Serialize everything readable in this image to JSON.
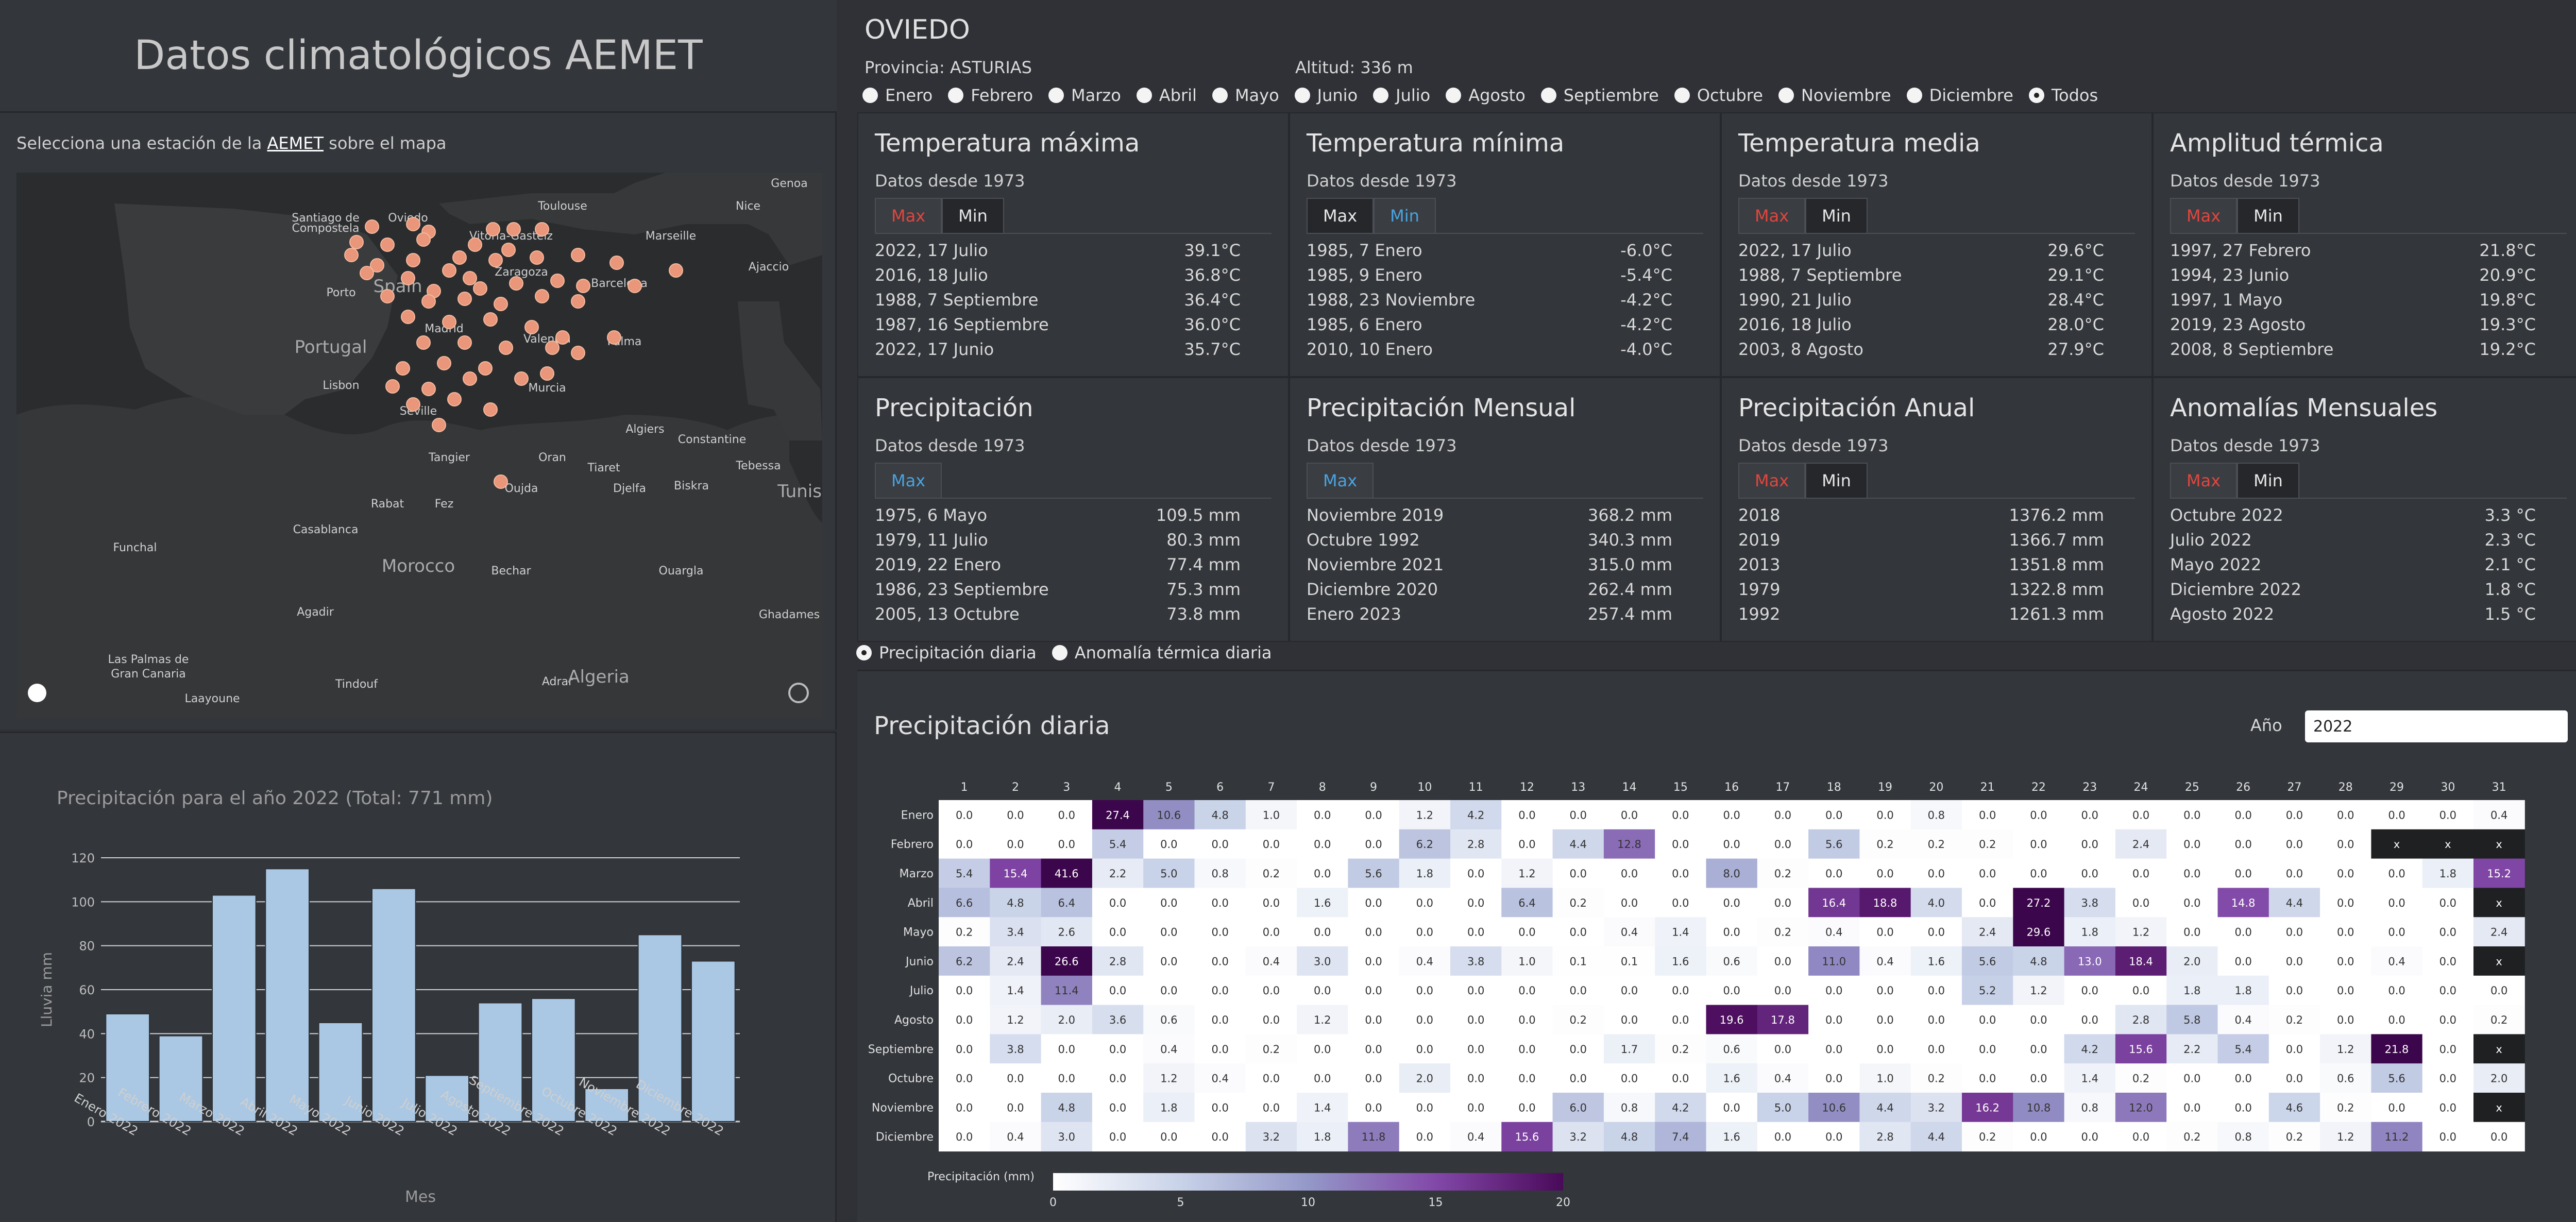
{
  "app_title": "Datos climatológicos AEMET",
  "map": {
    "prompt_prefix": "Selecciona una estación de la ",
    "prompt_link": "AEMET",
    "prompt_suffix": " sobre el mapa",
    "labels": [
      "Santiago de",
      "Compostela",
      "Oviedo",
      "Vitoria-Gasteiz",
      "Toulouse",
      "Nice",
      "Genoa",
      "Marseille",
      "Ajaccio",
      "Zaragoza",
      "Barcelona",
      "Porto",
      "Spain",
      "Madrid",
      "Valencia",
      "Palma",
      "Portugal",
      "Lisbon",
      "Murcia",
      "Seville",
      "Algiers",
      "Constantine",
      "Tunis",
      "Tangier",
      "Oran",
      "Tiaret",
      "Tebessa",
      "Rabat",
      "Fez",
      "Oujda",
      "Djelfa",
      "Biskra",
      "Casablanca",
      "Morocco",
      "Bechar",
      "Ouargla",
      "Funchal",
      "Agadir",
      "Ghadames",
      "Las Palmas de",
      "Gran Canaria",
      "Tindouf",
      "Adrar",
      "Algeria",
      "Laayoune"
    ]
  },
  "bar_chart": {
    "title": "Precipitación para el año 2022 (Total: 771 mm)",
    "xlabel": "Mes",
    "ylabel": "Lluvia mm"
  },
  "chart_data": [
    {
      "type": "bar",
      "title": "Precipitación para el año 2022 (Total: 771 mm)",
      "xlabel": "Mes",
      "ylabel": "Lluvia mm",
      "ylim": [
        0,
        120
      ],
      "yticks": [
        0,
        20,
        40,
        60,
        80,
        100,
        120
      ],
      "categories": [
        "Enero 2022",
        "Febrero 2022",
        "Marzo 2022",
        "Abril 2022",
        "Mayo 2022",
        "Junio 2022",
        "Julio 2022",
        "Agosto 2022",
        "Septiembre 2022",
        "Octubre 2022",
        "Noviembre 2022",
        "Diciembre 2022"
      ],
      "values": [
        49,
        39,
        103,
        115,
        45,
        106,
        21,
        54,
        56,
        15,
        85,
        73
      ],
      "color": "#aac8e4",
      "grid": true
    },
    {
      "type": "heatmap",
      "title": "Precipitación diaria",
      "colorbar_label": "Precipitación (mm)",
      "colorbar_ticks": [
        0,
        5,
        10,
        15,
        20
      ],
      "x": [
        "1",
        "2",
        "3",
        "4",
        "5",
        "6",
        "7",
        "8",
        "9",
        "10",
        "11",
        "12",
        "13",
        "14",
        "15",
        "16",
        "17",
        "18",
        "19",
        "20",
        "21",
        "22",
        "23",
        "24",
        "25",
        "26",
        "27",
        "28",
        "29",
        "30",
        "31"
      ],
      "y": [
        "Enero",
        "Febrero",
        "Marzo",
        "Abril",
        "Mayo",
        "Junio",
        "Julio",
        "Agosto",
        "Septiembre",
        "Octubre",
        "Noviembre",
        "Diciembre"
      ],
      "values": [
        [
          "0.0",
          "0.0",
          "0.0",
          "27.4",
          "10.6",
          "4.8",
          "1.0",
          "0.0",
          "0.0",
          "1.2",
          "4.2",
          "0.0",
          "0.0",
          "0.0",
          "0.0",
          "0.0",
          "0.0",
          "0.0",
          "0.0",
          "0.8",
          "0.0",
          "0.0",
          "0.0",
          "0.0",
          "0.0",
          "0.0",
          "0.0",
          "0.0",
          "0.0",
          "0.0",
          "0.4"
        ],
        [
          "0.0",
          "0.0",
          "0.0",
          "5.4",
          "0.0",
          "0.0",
          "0.0",
          "0.0",
          "0.0",
          "6.2",
          "2.8",
          "0.0",
          "4.4",
          "12.8",
          "0.0",
          "0.0",
          "0.0",
          "5.6",
          "0.2",
          "0.2",
          "0.2",
          "0.0",
          "0.0",
          "2.4",
          "0.0",
          "0.0",
          "0.0",
          "0.0",
          "x",
          "x",
          "x"
        ],
        [
          "5.4",
          "15.4",
          "41.6",
          "2.2",
          "5.0",
          "0.8",
          "0.2",
          "0.0",
          "5.6",
          "1.8",
          "0.0",
          "1.2",
          "0.0",
          "0.0",
          "0.0",
          "8.0",
          "0.2",
          "0.0",
          "0.0",
          "0.0",
          "0.0",
          "0.0",
          "0.0",
          "0.0",
          "0.0",
          "0.0",
          "0.0",
          "0.0",
          "0.0",
          "1.8",
          "15.2"
        ],
        [
          "6.6",
          "4.8",
          "6.4",
          "0.0",
          "0.0",
          "0.0",
          "0.0",
          "1.6",
          "0.0",
          "0.0",
          "0.0",
          "6.4",
          "0.2",
          "0.0",
          "0.0",
          "0.0",
          "0.0",
          "16.4",
          "18.8",
          "4.0",
          "0.0",
          "27.2",
          "3.8",
          "0.0",
          "0.0",
          "14.8",
          "4.4",
          "0.0",
          "0.0",
          "0.0",
          "x"
        ],
        [
          "0.2",
          "3.4",
          "2.6",
          "0.0",
          "0.0",
          "0.0",
          "0.0",
          "0.0",
          "0.0",
          "0.0",
          "0.0",
          "0.0",
          "0.0",
          "0.4",
          "1.4",
          "0.0",
          "0.2",
          "0.4",
          "0.0",
          "0.0",
          "2.4",
          "29.6",
          "1.8",
          "1.2",
          "0.0",
          "0.0",
          "0.0",
          "0.0",
          "0.0",
          "0.0",
          "2.4"
        ],
        [
          "6.2",
          "2.4",
          "26.6",
          "2.8",
          "0.0",
          "0.0",
          "0.4",
          "3.0",
          "0.0",
          "0.4",
          "3.8",
          "1.0",
          "0.1",
          "0.1",
          "1.6",
          "0.6",
          "0.0",
          "11.0",
          "0.4",
          "1.6",
          "5.6",
          "4.8",
          "13.0",
          "18.4",
          "2.0",
          "0.0",
          "0.0",
          "0.0",
          "0.4",
          "0.0",
          "x"
        ],
        [
          "0.0",
          "1.4",
          "11.4",
          "0.0",
          "0.0",
          "0.0",
          "0.0",
          "0.0",
          "0.0",
          "0.0",
          "0.0",
          "0.0",
          "0.0",
          "0.0",
          "0.0",
          "0.0",
          "0.0",
          "0.0",
          "0.0",
          "0.0",
          "5.2",
          "1.2",
          "0.0",
          "0.0",
          "1.8",
          "1.8",
          "0.0",
          "0.0",
          "0.0",
          "0.0",
          "0.0"
        ],
        [
          "0.0",
          "1.2",
          "2.0",
          "3.6",
          "0.6",
          "0.0",
          "0.0",
          "1.2",
          "0.0",
          "0.0",
          "0.0",
          "0.0",
          "0.2",
          "0.0",
          "0.0",
          "19.6",
          "17.8",
          "0.0",
          "0.0",
          "0.0",
          "0.0",
          "0.0",
          "0.0",
          "2.8",
          "5.8",
          "0.4",
          "0.2",
          "0.0",
          "0.0",
          "0.0",
          "0.2"
        ],
        [
          "0.0",
          "3.8",
          "0.0",
          "0.0",
          "0.4",
          "0.0",
          "0.2",
          "0.0",
          "0.0",
          "0.0",
          "0.0",
          "0.0",
          "0.0",
          "1.7",
          "0.2",
          "0.6",
          "0.0",
          "0.0",
          "0.0",
          "0.0",
          "0.0",
          "0.0",
          "4.2",
          "15.6",
          "2.2",
          "5.4",
          "0.0",
          "1.2",
          "21.8",
          "0.0",
          "x"
        ],
        [
          "0.0",
          "0.0",
          "0.0",
          "0.0",
          "1.2",
          "0.4",
          "0.0",
          "0.0",
          "0.0",
          "2.0",
          "0.0",
          "0.0",
          "0.0",
          "0.0",
          "0.0",
          "1.6",
          "0.4",
          "0.0",
          "1.0",
          "0.2",
          "0.0",
          "0.0",
          "1.4",
          "0.2",
          "0.0",
          "0.0",
          "0.0",
          "0.6",
          "5.6",
          "0.0",
          "2.0"
        ],
        [
          "0.0",
          "0.0",
          "4.8",
          "0.0",
          "1.8",
          "0.0",
          "0.0",
          "1.4",
          "0.0",
          "0.0",
          "0.0",
          "0.0",
          "6.0",
          "0.8",
          "4.2",
          "0.0",
          "5.0",
          "10.6",
          "4.4",
          "3.2",
          "16.2",
          "10.8",
          "0.8",
          "12.0",
          "0.0",
          "0.0",
          "4.6",
          "0.2",
          "0.0",
          "0.0",
          "x"
        ],
        [
          "0.0",
          "0.4",
          "3.0",
          "0.0",
          "0.0",
          "0.0",
          "3.2",
          "1.8",
          "11.8",
          "0.0",
          "0.4",
          "15.6",
          "3.2",
          "4.8",
          "7.4",
          "1.6",
          "0.0",
          "0.0",
          "2.8",
          "4.4",
          "0.2",
          "0.0",
          "0.0",
          "0.0",
          "0.2",
          "0.8",
          "0.2",
          "1.2",
          "11.2",
          "0.0",
          "0.0"
        ]
      ]
    }
  ],
  "station": {
    "name": "OVIEDO",
    "provincia": "Provincia: ASTURIAS",
    "altitud": "Altitud: 336 m"
  },
  "months": [
    "Enero",
    "Febrero",
    "Marzo",
    "Abril",
    "Mayo",
    "Junio",
    "Julio",
    "Agosto",
    "Septiembre",
    "Octubre",
    "Noviembre",
    "Diciembre",
    "Todos"
  ],
  "selected_month": "Todos",
  "cards": [
    {
      "title": "Temperatura máxima",
      "since": "Datos desde 1973",
      "buttons": [
        {
          "label": "Max",
          "style": "max"
        },
        {
          "label": "Min",
          "style": "min"
        }
      ],
      "rows": [
        [
          "2022, 17 Julio",
          "39.1°C"
        ],
        [
          "2016, 18 Julio",
          "36.8°C"
        ],
        [
          "1988, 7 Septiembre",
          "36.4°C"
        ],
        [
          "1987, 16 Septiembre",
          "36.0°C"
        ],
        [
          "2022, 17 Junio",
          "35.7°C"
        ]
      ]
    },
    {
      "title": "Temperatura mínima",
      "since": "Datos desde 1973",
      "buttons": [
        {
          "label": "Max",
          "style": "min"
        },
        {
          "label": "Min",
          "style": "blue"
        }
      ],
      "rows": [
        [
          "1985, 7 Enero",
          "-6.0°C"
        ],
        [
          "1985, 9 Enero",
          "-5.4°C"
        ],
        [
          "1988, 23 Noviembre",
          "-4.2°C"
        ],
        [
          "1985, 6 Enero",
          "-4.2°C"
        ],
        [
          "2010, 10 Enero",
          "-4.0°C"
        ]
      ]
    },
    {
      "title": "Temperatura media",
      "since": "Datos desde 1973",
      "buttons": [
        {
          "label": "Max",
          "style": "max"
        },
        {
          "label": "Min",
          "style": "min"
        }
      ],
      "rows": [
        [
          "2022, 17 Julio",
          "29.6°C"
        ],
        [
          "1988, 7 Septiembre",
          "29.1°C"
        ],
        [
          "1990, 21 Julio",
          "28.4°C"
        ],
        [
          "2016, 18 Julio",
          "28.0°C"
        ],
        [
          "2003, 8 Agosto",
          "27.9°C"
        ]
      ]
    },
    {
      "title": "Amplitud térmica",
      "since": "Datos desde 1973",
      "buttons": [
        {
          "label": "Max",
          "style": "max"
        },
        {
          "label": "Min",
          "style": "min"
        }
      ],
      "rows": [
        [
          "1997, 27 Febrero",
          "21.8°C"
        ],
        [
          "1994, 23 Junio",
          "20.9°C"
        ],
        [
          "1997, 1 Mayo",
          "19.8°C"
        ],
        [
          "2019, 23 Agosto",
          "19.3°C"
        ],
        [
          "2008, 8 Septiembre",
          "19.2°C"
        ]
      ]
    },
    {
      "title": "Precipitación",
      "since": "Datos desde 1973",
      "buttons": [
        {
          "label": "Max",
          "style": "blue"
        }
      ],
      "rows": [
        [
          "1975, 6 Mayo",
          "109.5 mm"
        ],
        [
          "1979, 11 Julio",
          "80.3 mm"
        ],
        [
          "2019, 22 Enero",
          "77.4 mm"
        ],
        [
          "1986, 23 Septiembre",
          "75.3 mm"
        ],
        [
          "2005, 13 Octubre",
          "73.8 mm"
        ]
      ]
    },
    {
      "title": "Precipitación Mensual",
      "since": "Datos desde 1973",
      "buttons": [
        {
          "label": "Max",
          "style": "blue"
        }
      ],
      "rows": [
        [
          "Noviembre 2019",
          "368.2 mm"
        ],
        [
          "Octubre 1992",
          "340.3 mm"
        ],
        [
          "Noviembre 2021",
          "315.0 mm"
        ],
        [
          "Diciembre 2020",
          "262.4 mm"
        ],
        [
          "Enero 2023",
          "257.4 mm"
        ]
      ]
    },
    {
      "title": "Precipitación Anual",
      "since": "Datos desde 1973",
      "buttons": [
        {
          "label": "Max",
          "style": "max"
        },
        {
          "label": "Min",
          "style": "min"
        }
      ],
      "rows": [
        [
          "2018",
          "1376.2 mm"
        ],
        [
          "2019",
          "1366.7 mm"
        ],
        [
          "2013",
          "1351.8 mm"
        ],
        [
          "1979",
          "1322.8 mm"
        ],
        [
          "1992",
          "1261.3 mm"
        ]
      ]
    },
    {
      "title": "Anomalías Mensuales",
      "since": "Datos desde 1973",
      "buttons": [
        {
          "label": "Max",
          "style": "max"
        },
        {
          "label": "Min",
          "style": "min"
        }
      ],
      "rows": [
        [
          "Octubre 2022",
          "3.3 °C"
        ],
        [
          "Julio 2022",
          "2.3 °C"
        ],
        [
          "Mayo 2022",
          "2.1 °C"
        ],
        [
          "Diciembre 2022",
          "1.8 °C"
        ],
        [
          "Agosto 2022",
          "1.5 °C"
        ]
      ]
    }
  ],
  "daily_radios": [
    {
      "label": "Precipitación diaria",
      "checked": true
    },
    {
      "label": "Anomalía térmica diaria",
      "checked": false
    }
  ],
  "heatmap_panel": {
    "title": "Precipitación diaria",
    "year_label": "Año",
    "year_value": "2022"
  }
}
